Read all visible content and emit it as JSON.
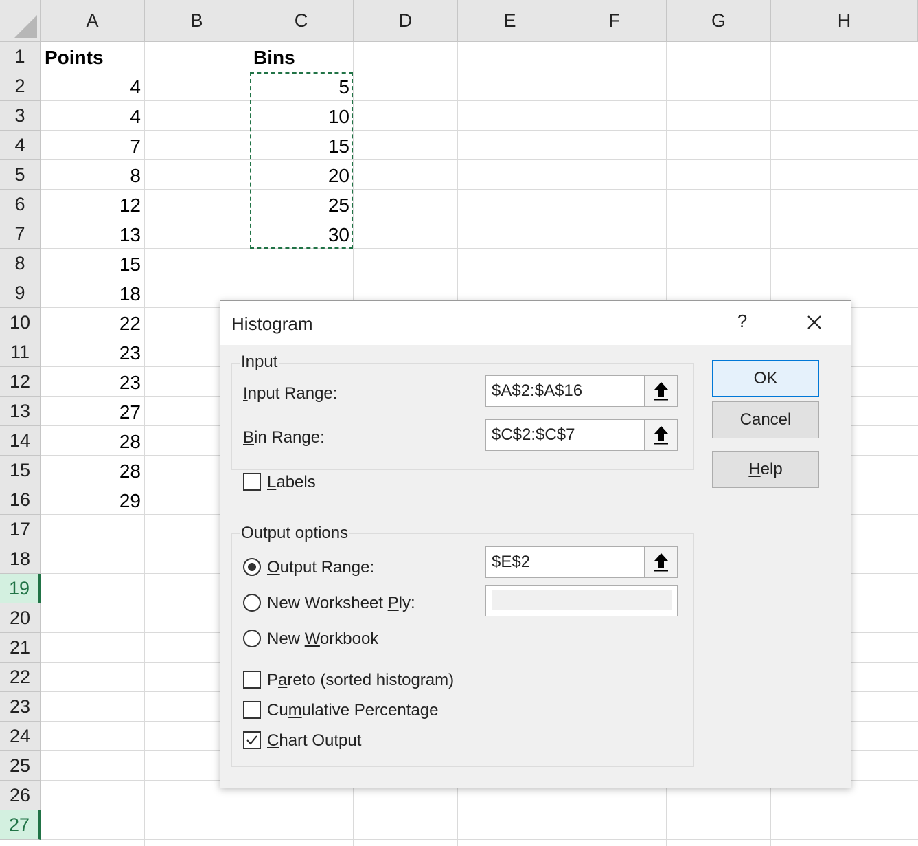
{
  "sheet": {
    "columns": [
      "A",
      "B",
      "C",
      "D",
      "E",
      "F",
      "G",
      "H"
    ],
    "rows": [
      "1",
      "2",
      "3",
      "4",
      "5",
      "6",
      "7",
      "8",
      "9",
      "10",
      "11",
      "12",
      "13",
      "14",
      "15",
      "16",
      "17",
      "18",
      "19",
      "20",
      "21",
      "22",
      "23",
      "24",
      "25",
      "26",
      "27"
    ],
    "points_header": "Points",
    "points": [
      "4",
      "4",
      "7",
      "8",
      "12",
      "13",
      "15",
      "18",
      "22",
      "23",
      "23",
      "27",
      "28",
      "28",
      "29"
    ],
    "bins_header": "Bins",
    "bins": [
      "5",
      "10",
      "15",
      "20",
      "25",
      "30"
    ],
    "accent_color": "#217346"
  },
  "dialog": {
    "title": "Histogram",
    "help_glyph": "?",
    "input_group": {
      "legend": "Input",
      "input_range_label": "nput Range:",
      "input_range_mnemonic": "I",
      "input_range_value": "$A$2:$A$16",
      "bin_range_label": "in Range:",
      "bin_range_mnemonic": "B",
      "bin_range_value": "$C$2:$C$7"
    },
    "labels_checkbox": {
      "mnemonic": "L",
      "label": "abels",
      "checked": false
    },
    "output_group": {
      "legend": "Output options",
      "output_range": {
        "mnemonic": "O",
        "label": "utput Range:",
        "value": "$E$2",
        "selected": true
      },
      "new_worksheet": {
        "label_pre": "New Worksheet ",
        "mnemonic": "P",
        "label_post": "ly:",
        "selected": false
      },
      "new_workbook": {
        "label_pre": "New ",
        "mnemonic": "W",
        "label_post": "orkbook",
        "selected": false
      },
      "pareto": {
        "label_pre": "P",
        "mnemonic": "a",
        "label_post": "reto (sorted histogram)",
        "checked": false
      },
      "cumulative": {
        "label_pre": "Cu",
        "mnemonic": "m",
        "label_post": "ulative Percentage",
        "checked": false
      },
      "chart_output": {
        "mnemonic": "C",
        "label_post": "hart Output",
        "checked": true
      }
    },
    "buttons": {
      "ok": "OK",
      "cancel": "Cancel",
      "help_mnemonic": "H",
      "help_post": "elp"
    }
  }
}
